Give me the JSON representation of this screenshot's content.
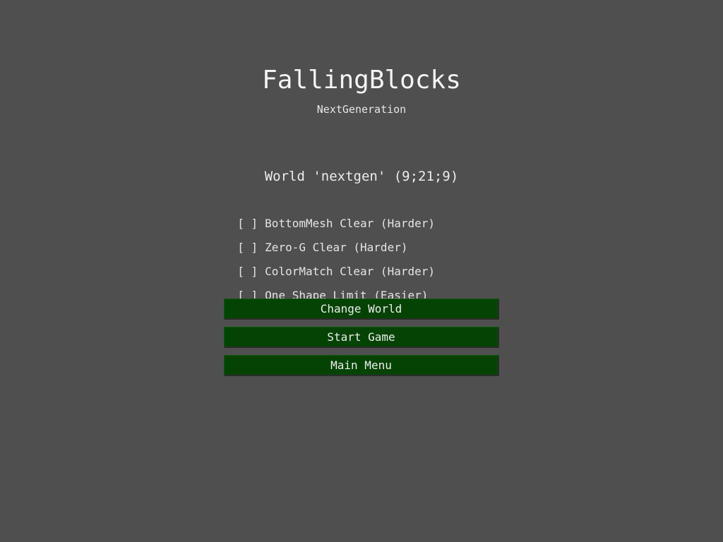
{
  "header": {
    "title": "FallingBlocks",
    "subtitle": "NextGeneration"
  },
  "world": {
    "label": "World 'nextgen' (9;21;9)"
  },
  "options": [
    {
      "checkbox": "[ ]",
      "label": "BottomMesh Clear (Harder)",
      "checked": false
    },
    {
      "checkbox": "[ ]",
      "label": "Zero-G Clear (Harder)",
      "checked": false
    },
    {
      "checkbox": "[ ]",
      "label": "ColorMatch Clear (Harder)",
      "checked": false
    },
    {
      "checkbox": "[ ]",
      "label": "One Shape Limit (Easier)",
      "checked": false
    }
  ],
  "buttons": {
    "change_world": "Change World",
    "start_game": "Start Game",
    "main_menu": "Main Menu"
  },
  "colors": {
    "background": "#4f4f4f",
    "button": "#054305",
    "text": "#ececec"
  }
}
